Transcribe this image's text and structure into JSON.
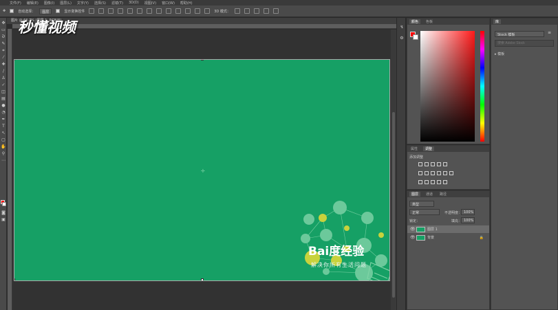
{
  "menu": [
    "文件(F)",
    "编辑(E)",
    "图像(I)",
    "图层(L)",
    "文字(Y)",
    "选择(S)",
    "滤镜(T)",
    "3D(D)",
    "视图(V)",
    "窗口(W)",
    "帮助(H)"
  ],
  "options": {
    "auto_select_label": "自动选择：",
    "auto_select_value": "图层",
    "transform_controls_label": "显示变换控件",
    "mode3d_label": "3D 模式："
  },
  "document": {
    "tab_label": "图片 @ 66.7% (图层 1, RGB/8)",
    "canvas_color": "#16a065"
  },
  "watermark": "秒懂视频",
  "baidu": {
    "word": "Bai度经验",
    "slogan": "解决你所有生活问题"
  },
  "color_panel": {
    "tabs": [
      "颜色",
      "色板"
    ],
    "foreground": "#ff0000",
    "background": "#ffffff"
  },
  "adjust_panel": {
    "tabs": [
      "属性",
      "调整"
    ],
    "add_label": "添加调整"
  },
  "layers_panel": {
    "tabs": [
      "图层",
      "通道",
      "路径"
    ],
    "kind_label": "类型",
    "blend_mode": "正常",
    "opacity_label": "不透明度：",
    "opacity_value": "100%",
    "lock_label": "锁定：",
    "fill_label": "填充：",
    "fill_value": "100%",
    "layers": [
      {
        "name": "图层 1",
        "selected": true
      },
      {
        "name": "背景",
        "selected": false
      }
    ]
  },
  "library_panel": {
    "tab": "库",
    "dropdown": "Stock 模板",
    "search_placeholder": "搜索 Adobe Stock",
    "item": "模板"
  }
}
